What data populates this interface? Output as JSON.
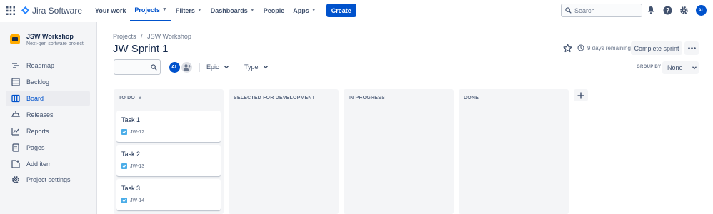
{
  "topnav": {
    "brand": "Jira Software",
    "items": [
      {
        "label": "Your work",
        "dropdown": false,
        "active": false
      },
      {
        "label": "Projects",
        "dropdown": true,
        "active": true
      },
      {
        "label": "Filters",
        "dropdown": true,
        "active": false
      },
      {
        "label": "Dashboards",
        "dropdown": true,
        "active": false
      },
      {
        "label": "People",
        "dropdown": false,
        "active": false
      },
      {
        "label": "Apps",
        "dropdown": true,
        "active": false
      }
    ],
    "create_label": "Create",
    "search_placeholder": "Search",
    "user_initials": "AL"
  },
  "sidebar": {
    "project_name": "JSW Workshop",
    "project_type": "Next-gen software project",
    "items": [
      {
        "label": "Roadmap",
        "icon": "roadmap-icon",
        "active": false
      },
      {
        "label": "Backlog",
        "icon": "backlog-icon",
        "active": false
      },
      {
        "label": "Board",
        "icon": "board-icon",
        "active": true
      },
      {
        "label": "Releases",
        "icon": "releases-icon",
        "active": false
      },
      {
        "label": "Reports",
        "icon": "reports-icon",
        "active": false
      },
      {
        "label": "Pages",
        "icon": "pages-icon",
        "active": false
      },
      {
        "label": "Add item",
        "icon": "add-item-icon",
        "active": false
      },
      {
        "label": "Project settings",
        "icon": "settings-icon",
        "active": false
      }
    ]
  },
  "main": {
    "breadcrumb": [
      "Projects",
      "JSW Workshop"
    ],
    "breadcrumb_sep": "/",
    "title": "JW Sprint 1",
    "remaining": "9 days remaining",
    "complete_label": "Complete sprint",
    "filters": {
      "avatar_initials": "AL",
      "epic_label": "Epic",
      "type_label": "Type",
      "group_by_label": "GROUP BY",
      "group_by_value": "None"
    },
    "columns": [
      {
        "title": "TO DO",
        "count": "8"
      },
      {
        "title": "SELECTED FOR DEVELOPMENT",
        "count": ""
      },
      {
        "title": "IN PROGRESS",
        "count": ""
      },
      {
        "title": "DONE",
        "count": ""
      }
    ],
    "cards": [
      {
        "title": "Task 1",
        "key": "JW-12"
      },
      {
        "title": "Task 2",
        "key": "JW-13"
      },
      {
        "title": "Task 3",
        "key": "JW-14"
      }
    ]
  },
  "colors": {
    "brand_blue": "#0052cc",
    "sidebar_bg": "#f4f5f7",
    "task_icon": "#4bade8",
    "project_icon": "#ffab00"
  }
}
